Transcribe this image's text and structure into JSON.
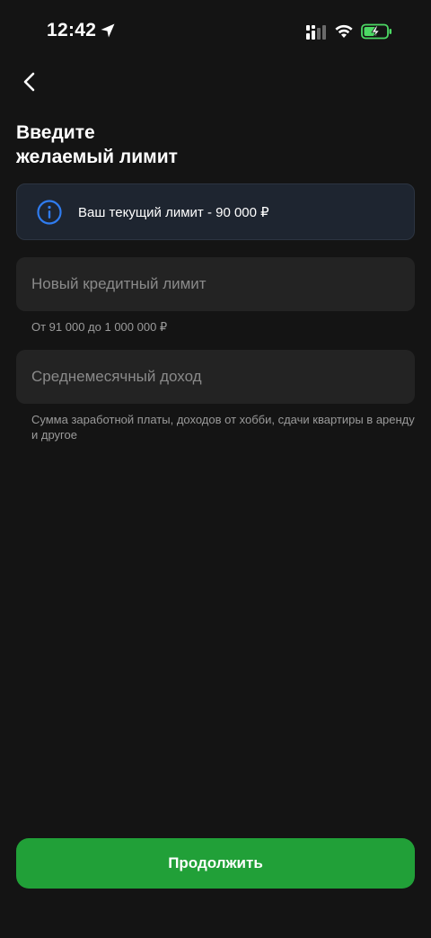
{
  "status_bar": {
    "time": "12:42",
    "icons": [
      "location-arrow-icon",
      "signal-icon",
      "wifi-icon",
      "battery-charging-icon"
    ]
  },
  "nav": {
    "back_icon": "chevron-left-icon"
  },
  "title": {
    "line1": "Введите",
    "line2": "желаемый лимит"
  },
  "info_card": {
    "icon": "info-icon",
    "text": "Ваш текущий лимит - 90 000 ₽"
  },
  "credit_limit": {
    "value": "",
    "placeholder": "Новый кредитный лимит",
    "hint": "От 91 000 до 1 000 000 ₽"
  },
  "income": {
    "value": "",
    "placeholder": "Среднемесячный доход",
    "hint": "Сумма заработной платы, доходов от хобби, сдачи квартиры в аренду и другое"
  },
  "continue_button": {
    "label": "Продолжить"
  },
  "colors": {
    "background": "#141414",
    "field": "#232323",
    "info_card": "#1e2530",
    "accent_blue": "#2f7cf0",
    "primary_green": "#21a038",
    "battery_green": "#4cd964"
  }
}
